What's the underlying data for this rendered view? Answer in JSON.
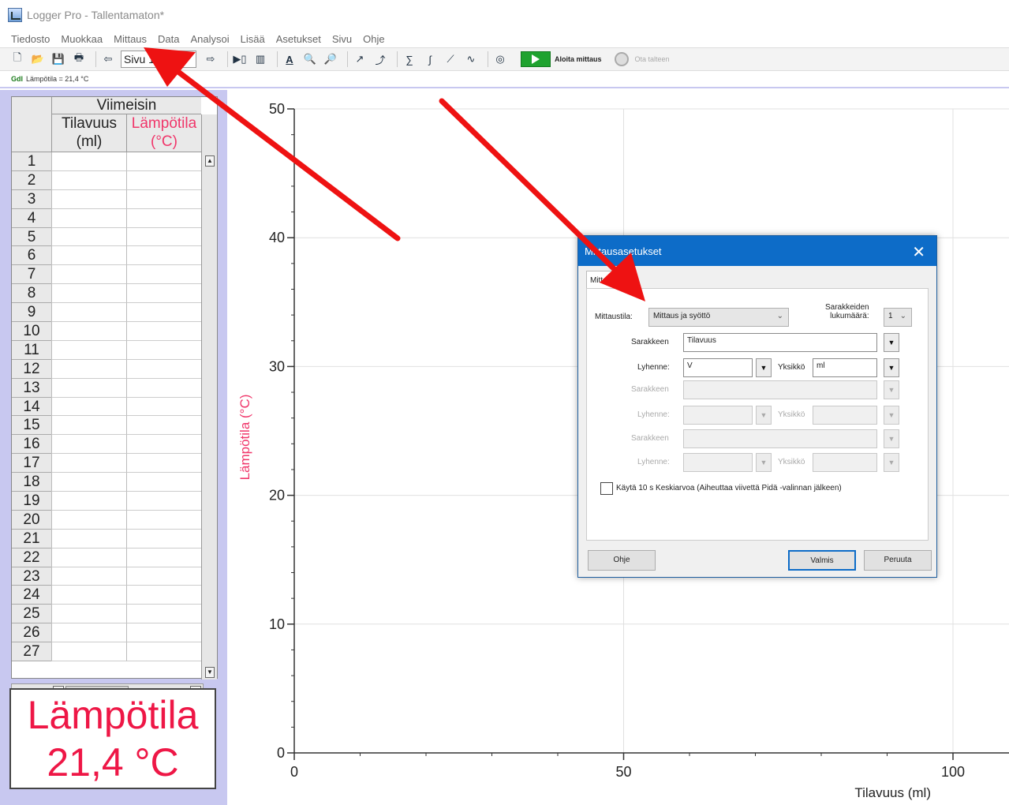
{
  "window": {
    "title": "Logger Pro - Tallentamaton*"
  },
  "menu": [
    "Tiedosto",
    "Muokkaa",
    "Mittaus",
    "Data",
    "Analysoi",
    "Lisää",
    "Asetukset",
    "Sivu",
    "Ohje"
  ],
  "toolbar": {
    "page_value": "Sivu 1",
    "start_label": "Aloita mittaus",
    "keep_label": "Ota talteen"
  },
  "sensor": {
    "prefix": "Gdl",
    "status": "Lämpötila = 21,4 °C"
  },
  "table": {
    "group_header": "Viimeisin",
    "col1_name": "Tilavuus",
    "col1_unit": "(ml)",
    "col2_name": "Lämpötila",
    "col2_unit": "(°C)",
    "row_numbers": [
      "1",
      "2",
      "3",
      "4",
      "5",
      "6",
      "7",
      "8",
      "9",
      "10",
      "11",
      "12",
      "13",
      "14",
      "15",
      "16",
      "17",
      "18",
      "19",
      "20",
      "21",
      "22",
      "23",
      "24",
      "25",
      "26",
      "27"
    ]
  },
  "meter": {
    "label": "Lämpötila",
    "value": "21,4 °C",
    "color": "#ee1746"
  },
  "graph": {
    "ylabel": "Lämpötila (°C)",
    "xlabel": "Tilavuus (ml)",
    "y_ticks": [
      "0",
      "10",
      "20",
      "30",
      "40",
      "50"
    ],
    "x_ticks": [
      "0",
      "50",
      "100"
    ],
    "ylabel_color": "#f0366a"
  },
  "dialog": {
    "title": "Mittausasetukset",
    "tab": "Mittaus",
    "mode_label": "Mittaustila:",
    "mode_value": "Mittaus ja syöttö",
    "columns_count_label_1": "Sarakkeiden",
    "columns_count_label_2": "lukumäärä:",
    "columns_count_value": "1",
    "row1": {
      "name_label": "Sarakkeen",
      "name_value": "Tilavuus",
      "abbr_label": "Lyhenne:",
      "abbr_value": "V",
      "unit_label": "Yksikkö",
      "unit_value": "ml"
    },
    "row2": {
      "name_label": "Sarakkeen",
      "abbr_label": "Lyhenne:",
      "unit_label": "Yksikkö"
    },
    "row3": {
      "name_label": "Sarakkeen",
      "abbr_label": "Lyhenne:",
      "unit_label": "Yksikkö"
    },
    "checkbox_label": "Käytä 10 s Keskiarvoa (Aiheuttaa viivettä Pidä -valinnan jälkeen)",
    "help_button": "Ohje",
    "done_button": "Valmis",
    "cancel_button": "Peruuta"
  },
  "colors": {
    "arrow": "#ee1212",
    "dialog_title": "#0d6cc8"
  }
}
